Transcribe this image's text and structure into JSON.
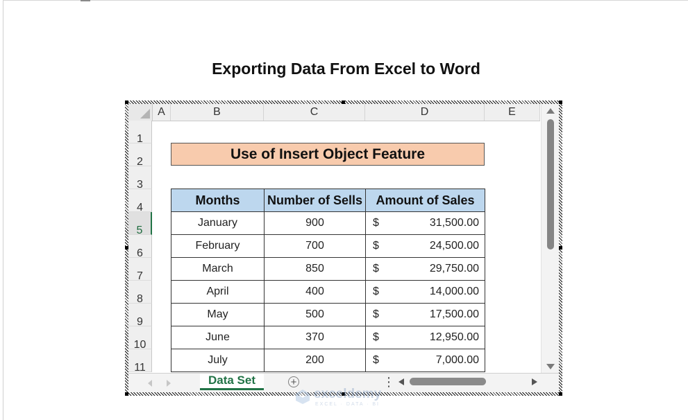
{
  "document": {
    "title": "Exporting Data From Excel to Word"
  },
  "spreadsheet": {
    "columns": [
      "A",
      "B",
      "C",
      "D",
      "E"
    ],
    "rows": [
      "1",
      "2",
      "3",
      "4",
      "5",
      "6",
      "7",
      "8",
      "9",
      "10",
      "11"
    ],
    "active_row": "5",
    "banner_text": "Use of Insert Object Feature",
    "table": {
      "headers": [
        "Months",
        "Number of Sells",
        "Amount of Sales"
      ],
      "rows": [
        {
          "month": "January",
          "sells": "900",
          "currency": "$",
          "amount": "31,500.00"
        },
        {
          "month": "February",
          "sells": "700",
          "currency": "$",
          "amount": "24,500.00"
        },
        {
          "month": "March",
          "sells": "850",
          "currency": "$",
          "amount": "29,750.00"
        },
        {
          "month": "April",
          "sells": "400",
          "currency": "$",
          "amount": "14,000.00"
        },
        {
          "month": "May",
          "sells": "500",
          "currency": "$",
          "amount": "17,500.00"
        },
        {
          "month": "June",
          "sells": "370",
          "currency": "$",
          "amount": "12,950.00"
        },
        {
          "month": "July",
          "sells": "200",
          "currency": "$",
          "amount": "7,000.00"
        }
      ]
    },
    "sheet_tab": "Data Set",
    "add_sheet_symbol": "+",
    "split_symbol": "⋮"
  },
  "watermark": {
    "name": "exceldemy",
    "tagline": "EXCEL · DATA · BI"
  },
  "colors": {
    "banner_fill": "#f8cbad",
    "header_fill": "#bdd7ee",
    "excel_green": "#217346"
  },
  "icons": {
    "select_all": "select-all-triangle-icon",
    "scroll_up": "arrow-up-icon",
    "scroll_down": "arrow-down-icon",
    "scroll_left": "arrow-left-icon",
    "scroll_right": "arrow-right-icon",
    "add_sheet": "plus-circle-icon",
    "watermark_logo": "exceldemy-logo-icon"
  }
}
